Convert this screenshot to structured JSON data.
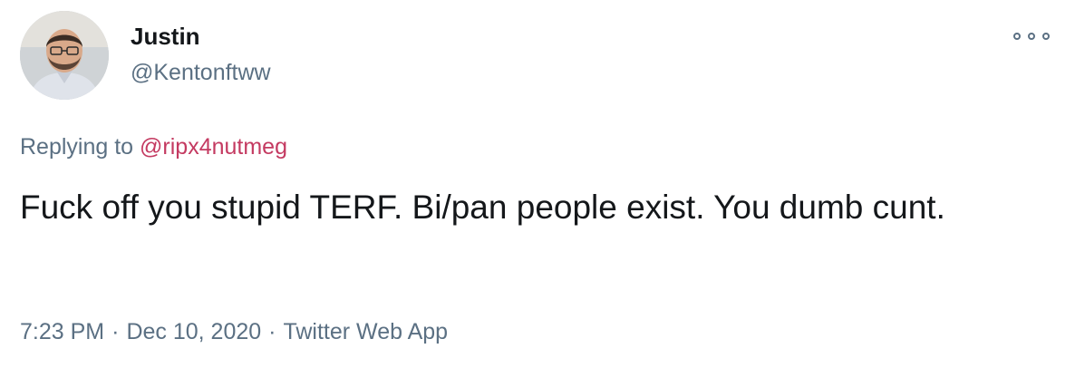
{
  "author": {
    "name": "Justin",
    "handle": "@Kentonftww"
  },
  "reply": {
    "prefix": "Replying to",
    "to_handle": "@ripx4nutmeg"
  },
  "tweet": {
    "text": "Fuck off you stupid TERF. Bi/pan people exist. You dumb cunt."
  },
  "meta": {
    "time": "7:23 PM",
    "separator": "·",
    "date": "Dec 10, 2020",
    "source": "Twitter Web App"
  },
  "icons": {
    "more": "more-options-icon"
  },
  "colors": {
    "name_text": "#14171a",
    "secondary_text": "#5b7083",
    "mention_link": "#c43a61",
    "background": "#ffffff"
  }
}
